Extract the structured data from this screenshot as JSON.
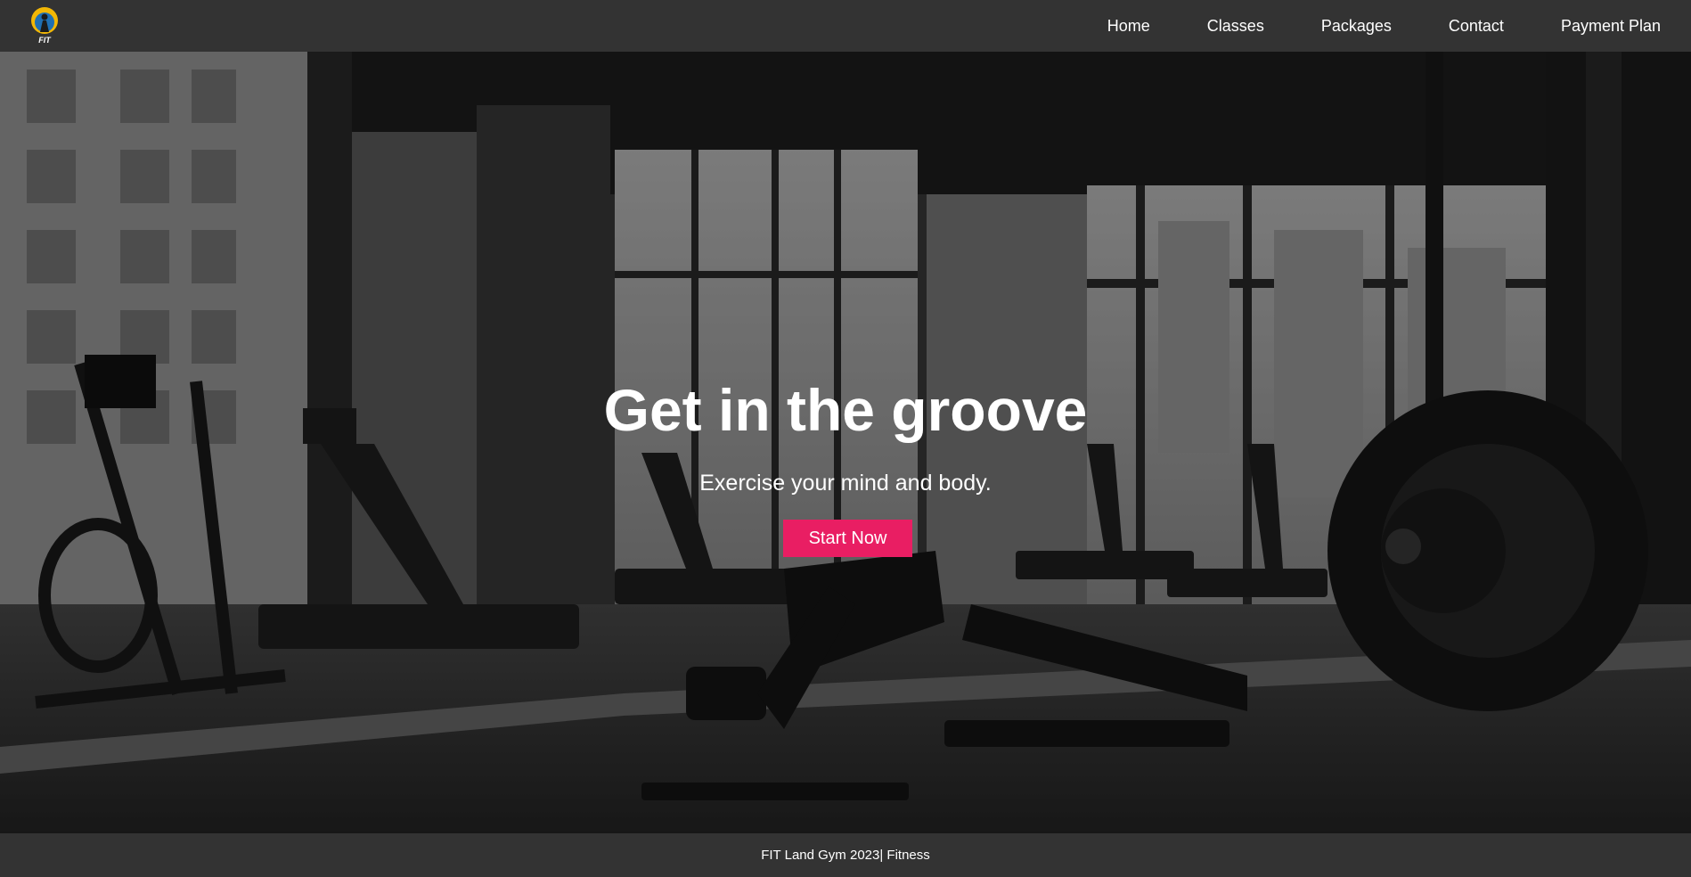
{
  "brand": {
    "logo_text": "FIT",
    "colors": {
      "accent": "#e91e63",
      "bar": "#333333",
      "text": "#ffffff"
    }
  },
  "nav": {
    "items": [
      {
        "label": "Home"
      },
      {
        "label": "Classes"
      },
      {
        "label": "Packages"
      },
      {
        "label": "Contact"
      },
      {
        "label": "Payment Plan"
      }
    ]
  },
  "hero": {
    "title": "Get in the groove",
    "subtitle": "Exercise your mind and body.",
    "cta_label": "Start Now",
    "background": "gym-interior-photo"
  },
  "footer": {
    "text": "FIT Land Gym 2023| Fitness"
  }
}
